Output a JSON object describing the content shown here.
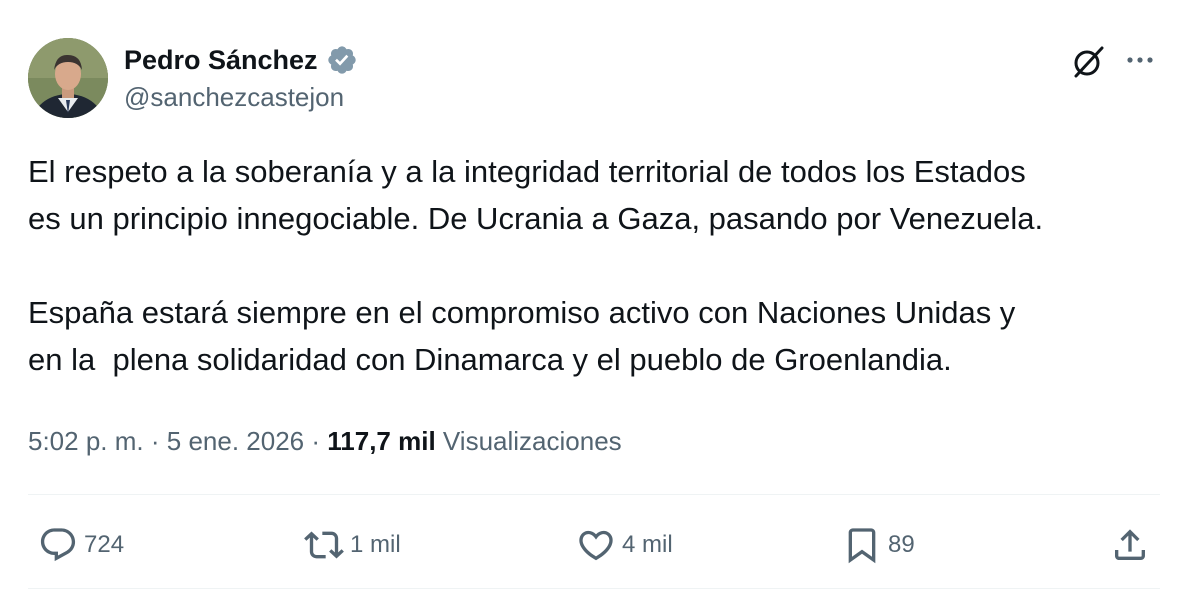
{
  "author": {
    "display_name": "Pedro Sánchez",
    "handle": "@sanchezcastejon",
    "verified": true
  },
  "icons": {
    "verified": "verified-badge-icon",
    "grok": "grok-icon",
    "more": "more-options-icon",
    "reply": "reply-icon",
    "repost": "repost-icon",
    "like": "like-icon",
    "bookmark": "bookmark-icon",
    "share": "share-icon"
  },
  "post": {
    "paragraphs": [
      "El respeto a la soberanía y a la integridad territorial de todos los Estados\nes un principio innegociable. De Ucrania a Gaza, pasando por Venezuela.",
      "España estará siempre en el compromiso activo con Naciones Unidas y\nen la  plena solidaridad con Dinamarca y el pueblo de Groenlandia."
    ]
  },
  "meta": {
    "time": "5:02 p. m.",
    "separator": "·",
    "date": "5 ene. 2026",
    "views_count": "117,7 mil",
    "views_label": "Visualizaciones"
  },
  "actions": {
    "replies": "724",
    "reposts": "1 mil",
    "likes": "4 mil",
    "bookmarks": "89"
  },
  "colors": {
    "primary_text": "#0f1419",
    "secondary_text": "#536471",
    "verified_badge": "#829aab",
    "divider": "#eff3f4"
  }
}
